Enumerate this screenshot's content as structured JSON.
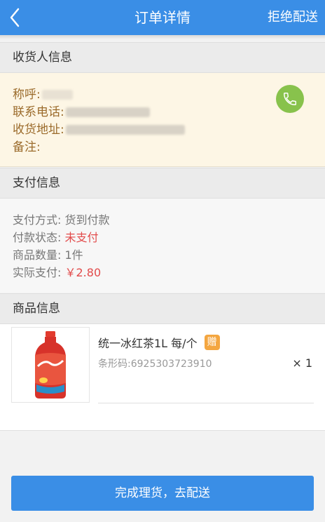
{
  "header": {
    "title": "订单详情",
    "reject_label": "拒绝配送",
    "back_icon": "chevron-left-icon"
  },
  "receiver": {
    "section_title": "收货人信息",
    "name_label": "称呼:",
    "phone_label": "联系电话:",
    "address_label": "收货地址:",
    "note_label": "备注:",
    "call_icon": "phone-icon"
  },
  "payment": {
    "section_title": "支付信息",
    "method_label": "支付方式:",
    "method_value": "货到付款",
    "status_label": "付款状态:",
    "status_value": "未支付",
    "count_label": "商品数量:",
    "count_value": "1件",
    "paid_label": "实际支付:",
    "paid_value": "￥2.80"
  },
  "goods": {
    "section_title": "商品信息",
    "items": [
      {
        "name": "统一冰红茶1L 每/个",
        "gift_badge": "赠",
        "barcode": "条形码:6925303723910",
        "qty": "× 1"
      }
    ]
  },
  "footer": {
    "primary_label": "完成理货，去配送"
  },
  "colors": {
    "brand_blue": "#3a8ee6",
    "receiver_text": "#9b6b2b",
    "alert_red": "#e24b4b",
    "call_green": "#88c24c",
    "gift_orange": "#f4a640"
  }
}
